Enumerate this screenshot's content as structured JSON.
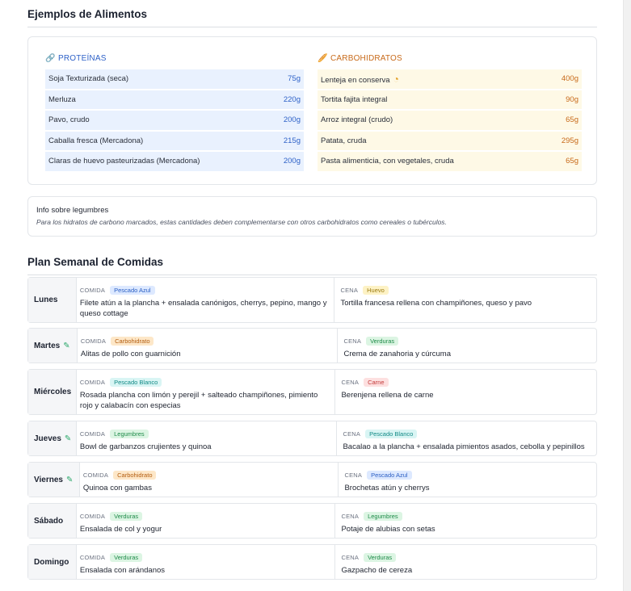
{
  "foods": {
    "title": "Ejemplos de Alimentos",
    "proteins": {
      "header": "PROTEÍNAS",
      "icon": "link-icon",
      "items": [
        {
          "name": "Soja Texturizada (seca)",
          "amount": "75g"
        },
        {
          "name": "Merluza",
          "amount": "220g"
        },
        {
          "name": "Pavo, crudo",
          "amount": "200g"
        },
        {
          "name": "Caballa fresca (Mercadona)",
          "amount": "215g"
        },
        {
          "name": "Claras de huevo pasteurizadas (Mercadona)",
          "amount": "200g"
        }
      ]
    },
    "carbs": {
      "header": "CARBOHIDRATOS",
      "icon": "bread-icon",
      "items": [
        {
          "name": "Lenteja en conserva",
          "amount": "400g"
        },
        {
          "name": "Tortita fajita integral",
          "amount": "90g"
        },
        {
          "name": "Arroz integral (crudo)",
          "amount": "65g"
        },
        {
          "name": "Patata, cruda",
          "amount": "295g"
        },
        {
          "name": "Pasta alimenticia, con vegetales, cruda",
          "amount": "65g"
        }
      ]
    },
    "legume_info": {
      "title": "Info sobre legumbres",
      "text": "Para los hidratos de carbono marcados, estas cantidades deben complementarse con otros carbohidratos como cereales o tubérculos."
    }
  },
  "plan": {
    "title": "Plan Semanal de Comidas",
    "lunch_label": "COMIDA",
    "dinner_label": "CENA",
    "days": [
      {
        "day": "Lunes",
        "lunch_tag": "Pescado Azul",
        "lunch": "Filete atún a la plancha + ensalada canónigos, cherrys, pepino, mango y queso cottage",
        "dinner_tag": "Huevo",
        "dinner": "Tortilla francesa rellena con champiñones, queso y pavo"
      },
      {
        "day": "Martes",
        "lunch_tag": "Carbohidrato",
        "lunch": "Alitas de pollo con guarnición",
        "dinner_tag": "Verduras",
        "dinner": "Crema de zanahoria y cúrcuma"
      },
      {
        "day": "Miércoles",
        "lunch_tag": "Pescado Blanco",
        "lunch": "Rosada plancha con limón y perejil + salteado champiñones, pimiento rojo y calabacín con especias",
        "dinner_tag": "Carne",
        "dinner": "Berenjena rellena de carne"
      },
      {
        "day": "Jueves",
        "lunch_tag": "Legumbres",
        "lunch": "Bowl de garbanzos crujientes y quinoa",
        "dinner_tag": "Pescado Blanco",
        "dinner": "Bacalao a la plancha + ensalada pimientos asados, cebolla y pepinillos"
      },
      {
        "day": "Viernes",
        "lunch_tag": "Carbohidrato",
        "lunch": "Quinoa con gambas",
        "dinner_tag": "Pescado Azul",
        "dinner": "Brochetas atún y cherrys"
      },
      {
        "day": "Sábado",
        "lunch_tag": "Verduras",
        "lunch": "Ensalada de col y yogur",
        "dinner_tag": "Legumbres",
        "dinner": "Potaje de alubias con setas"
      },
      {
        "day": "Domingo",
        "lunch_tag": "Verduras",
        "lunch": "Ensalada con arándanos",
        "dinner_tag": "Verduras",
        "dinner": "Gazpacho de cereza"
      }
    ]
  }
}
